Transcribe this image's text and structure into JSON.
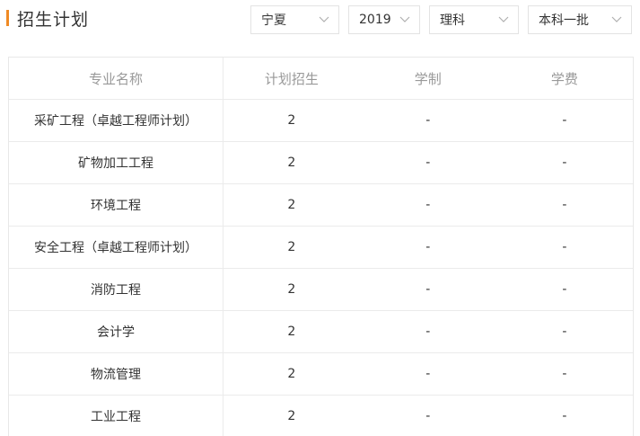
{
  "header": {
    "title": "招生计划"
  },
  "filters": {
    "province": "宁夏",
    "year": "2019",
    "subject": "理科",
    "batch": "本科一批"
  },
  "table": {
    "columns": [
      "专业名称",
      "计划招生",
      "学制",
      "学费"
    ],
    "rows": [
      {
        "major": "采矿工程（卓越工程师计划）",
        "plan": "2",
        "duration": "-",
        "fee": "-"
      },
      {
        "major": "矿物加工工程",
        "plan": "2",
        "duration": "-",
        "fee": "-"
      },
      {
        "major": "环境工程",
        "plan": "2",
        "duration": "-",
        "fee": "-"
      },
      {
        "major": "安全工程（卓越工程师计划）",
        "plan": "2",
        "duration": "-",
        "fee": "-"
      },
      {
        "major": "消防工程",
        "plan": "2",
        "duration": "-",
        "fee": "-"
      },
      {
        "major": "会计学",
        "plan": "2",
        "duration": "-",
        "fee": "-"
      },
      {
        "major": "物流管理",
        "plan": "2",
        "duration": "-",
        "fee": "-"
      },
      {
        "major": "工业工程",
        "plan": "2",
        "duration": "-",
        "fee": "-"
      }
    ]
  },
  "colors": {
    "accent": "#f08a24",
    "header_text": "#999999",
    "body_text": "#333333",
    "border": "#ebebeb"
  }
}
